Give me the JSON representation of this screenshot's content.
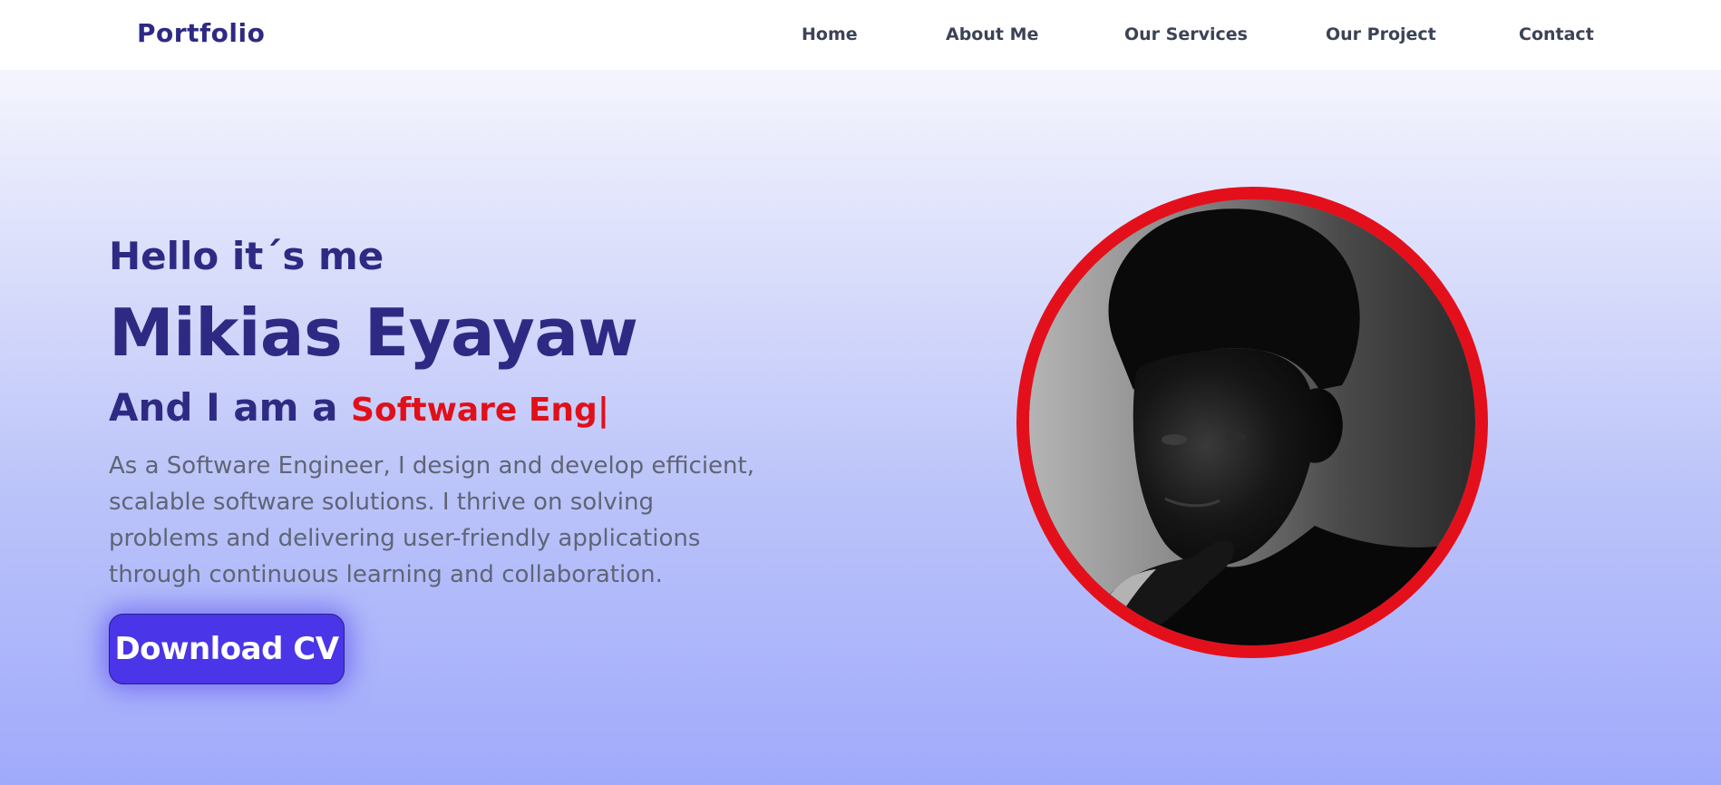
{
  "nav": {
    "brand": "Portfolio",
    "links": [
      {
        "label": "Home"
      },
      {
        "label": "About Me"
      },
      {
        "label": "Our Services"
      },
      {
        "label": "Our Project"
      },
      {
        "label": "Contact"
      }
    ]
  },
  "hero": {
    "greeting": "Hello it´s me",
    "name": "Mikias Eyayaw",
    "role_prefix": "And I am a",
    "role_typed": "Software Eng|",
    "description": "As a Software Engineer, I design and develop efficient, scalable software solutions. I thrive on solving problems and delivering user-friendly applications through continuous learning and collaboration.",
    "cta_label": "Download CV"
  },
  "colors": {
    "brand": "#2e2a84",
    "accent_red": "#e0101a",
    "button": "#4a35e8"
  }
}
